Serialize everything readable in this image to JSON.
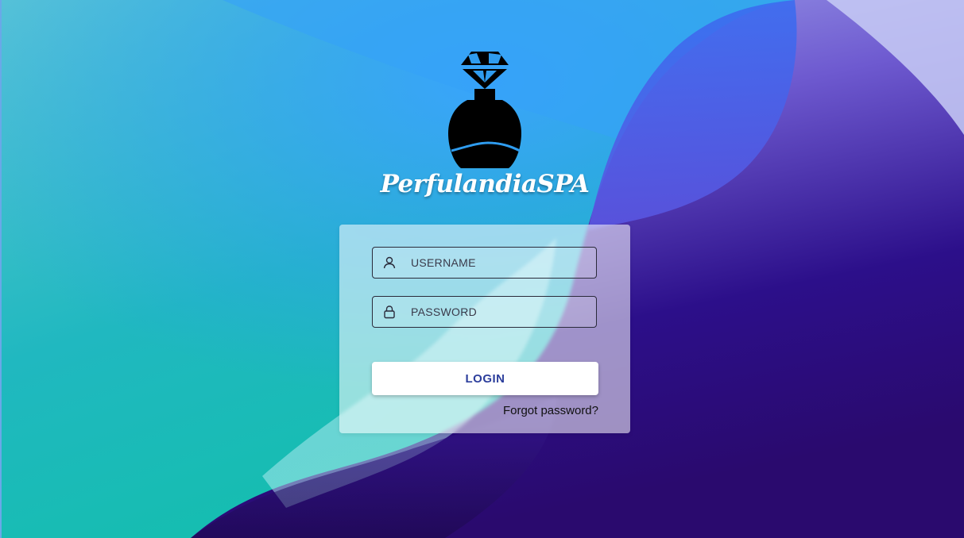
{
  "app": {
    "brand_name": "PerfulandiaSPA"
  },
  "login_form": {
    "username": {
      "placeholder": "USERNAME",
      "value": ""
    },
    "password": {
      "placeholder": "PASSWORD",
      "value": ""
    },
    "login_label": "LOGIN",
    "forgot_label": "Forgot password?"
  },
  "icons": {
    "logo": "perfume-bottle-icon",
    "username": "user-icon",
    "password": "lock-icon"
  },
  "colors": {
    "background_teal": "#1fb9b0",
    "background_blue": "#35a0f5",
    "background_purple": "#2a0a7a",
    "button_text": "#2c3e9c",
    "card_background": "rgba(255,255,255,0.55)"
  }
}
